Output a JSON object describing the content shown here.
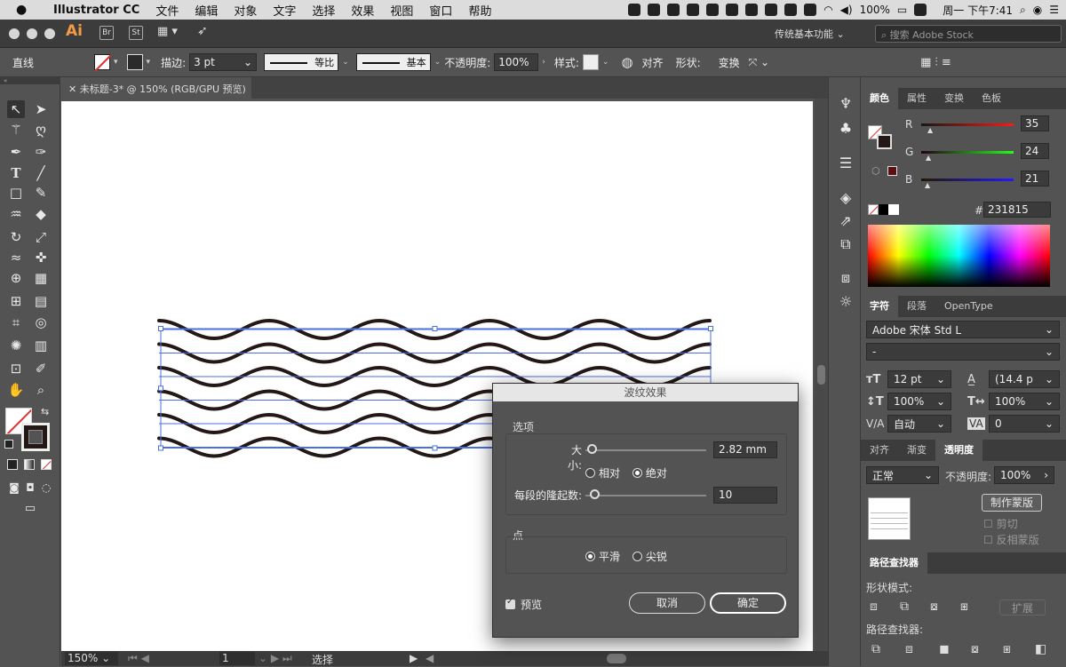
{
  "menubar": {
    "app_name": "Illustrator CC",
    "menus": [
      "文件",
      "编辑",
      "对象",
      "文字",
      "选择",
      "效果",
      "视图",
      "窗口",
      "帮助"
    ],
    "battery": "100%",
    "datetime": "周一 下午7:41"
  },
  "app_header": {
    "logo": "Ai",
    "bridge": "Br",
    "stock": "St",
    "workspace": "传统基本功能",
    "search_placeholder": "搜索 Adobe Stock"
  },
  "control_bar": {
    "selection_type": "直线",
    "stroke_label": "描边:",
    "stroke_weight": "3 pt",
    "profile": "等比",
    "brush": "基本",
    "opacity_label": "不透明度:",
    "opacity": "100%",
    "style_label": "样式:",
    "align": "对齐",
    "shape": "形状:",
    "transform": "变换"
  },
  "document": {
    "tab_title": "未标题-3* @ 150% (RGB/GPU 预览)"
  },
  "status_bar": {
    "zoom": "150%",
    "page": "1",
    "mode": "选择"
  },
  "color_panel": {
    "tabs": [
      "颜色",
      "属性",
      "变换",
      "色板"
    ],
    "r_label": "R",
    "r": "35",
    "g_label": "G",
    "g": "24",
    "b_label": "B",
    "b": "21",
    "hex_label": "#",
    "hex": "231815",
    "selected_color": "#231815"
  },
  "character_panel": {
    "tabs": [
      "字符",
      "段落",
      "OpenType"
    ],
    "font_family": "Adobe 宋体 Std L",
    "font_style": "-",
    "font_size": "12 pt",
    "leading": "(14.4 p",
    "vertical_scale": "100%",
    "horizontal_scale": "100%",
    "kerning": "自动",
    "tracking": "0"
  },
  "transparency_panel": {
    "tabs": [
      "对齐",
      "渐变",
      "透明度"
    ],
    "blend_mode": "正常",
    "opacity_label": "不透明度:",
    "opacity": "100%",
    "make_mask": "制作蒙版",
    "clip": "剪切",
    "invert_mask": "反相蒙版"
  },
  "pathfinder_panel": {
    "title": "路径查找器",
    "shape_modes": "形状模式:",
    "expand": "扩展",
    "pathfinders": "路径查找器:"
  },
  "zigzag_dialog": {
    "title": "波纹效果",
    "options_label": "选项",
    "size_label": "大小:",
    "size_value": "2.82 mm",
    "size_fraction": 0.05,
    "relative": "相对",
    "absolute": "绝对",
    "absolute_selected": true,
    "ridges_label": "每段的隆起数:",
    "ridges_value": "10",
    "ridges_fraction": 0.07,
    "points_label": "点",
    "smooth": "平滑",
    "corner": "尖锐",
    "smooth_selected": true,
    "preview": "预览",
    "preview_checked": true,
    "cancel": "取消",
    "ok": "确定"
  },
  "artwork": {
    "stroke_color": "#231815",
    "wave_lines": 6,
    "selection_color": "#4a6fe3"
  }
}
